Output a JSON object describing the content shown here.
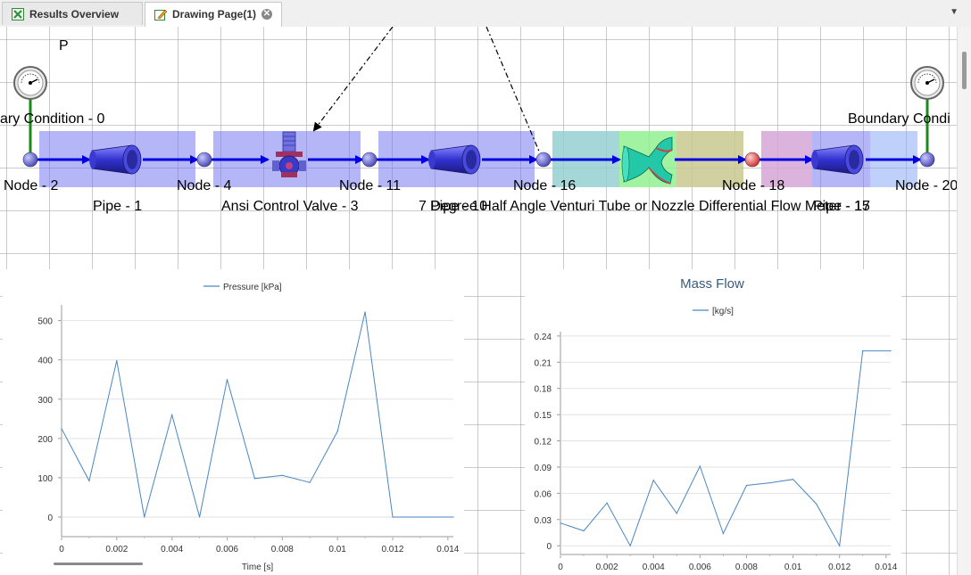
{
  "tabs": [
    {
      "label": "Results Overview",
      "active": false
    },
    {
      "label": "Drawing Page(1)",
      "active": true
    }
  ],
  "canvas": {
    "p_marker": "P",
    "boundary_left": "ary Condition - 0",
    "boundary_right": "Boundary Condi",
    "nodes": [
      "Node - 2",
      "Node - 4",
      "Node - 11",
      "Node - 16",
      "Node - 18",
      "Node - 20"
    ],
    "components": [
      "Pipe - 1",
      "Ansi Control Valve - 3",
      "7 Degree Half Angle Venturi Tube or Nozzle Differential Flow Meter - 15",
      "Pipe - 10",
      "Pipe - 17"
    ],
    "colors": {
      "pipe": "#6a6df0",
      "flow_arrow": "#0000e0",
      "node": "#6a6ad8",
      "node_red": "#e04040",
      "zone_teal": "#8fcdcf",
      "zone_green": "#90f090",
      "zone_olive": "#c8c890",
      "zone_pink": "#d6a6d6"
    }
  },
  "chart_data": [
    {
      "type": "line",
      "title": "",
      "legend": "Pressure [kPa]",
      "legend_position": "top-center",
      "xlabel": "Time [s]",
      "ylabel": "",
      "xlim": [
        0,
        0.0142
      ],
      "ylim": [
        -50,
        540
      ],
      "x_ticks": [
        "0",
        "0.002",
        "0.004",
        "0.006",
        "0.008",
        "0.01",
        "0.012",
        "0.014"
      ],
      "y_ticks": [
        "0",
        "100",
        "200",
        "300",
        "400",
        "500"
      ],
      "series": [
        {
          "name": "Pressure [kPa]",
          "color": "#4a86c0",
          "x": [
            0,
            0.001,
            0.002,
            0.003,
            0.004,
            0.005,
            0.006,
            0.007,
            0.008,
            0.009,
            0.01,
            0.011,
            0.012,
            0.013,
            0.0142
          ],
          "y": [
            225,
            92,
            398,
            0,
            260,
            0,
            350,
            98,
            106,
            88,
            218,
            522,
            0,
            0,
            0
          ]
        }
      ]
    },
    {
      "type": "line",
      "title": "Mass Flow",
      "legend": "[kg/s]",
      "legend_position": "top-center",
      "xlabel": "",
      "ylabel": "",
      "xlim": [
        0,
        0.0142
      ],
      "ylim": [
        -0.01,
        0.245
      ],
      "x_ticks": [
        "0",
        "0.002",
        "0.004",
        "0.006",
        "0.008",
        "0.01",
        "0.012",
        "0.014"
      ],
      "y_ticks": [
        "0",
        "0.03",
        "0.06",
        "0.09",
        "0.12",
        "0.15",
        "0.18",
        "0.21",
        "0.24"
      ],
      "series": [
        {
          "name": "[kg/s]",
          "color": "#4a86c0",
          "x": [
            0,
            0.001,
            0.002,
            0.003,
            0.004,
            0.005,
            0.006,
            0.007,
            0.008,
            0.009,
            0.01,
            0.011,
            0.012,
            0.013,
            0.0142
          ],
          "y": [
            0.026,
            0.017,
            0.049,
            0,
            0.075,
            0.037,
            0.091,
            0.014,
            0.069,
            0.072,
            0.076,
            0.048,
            0,
            0.223,
            0.223
          ]
        }
      ]
    }
  ]
}
